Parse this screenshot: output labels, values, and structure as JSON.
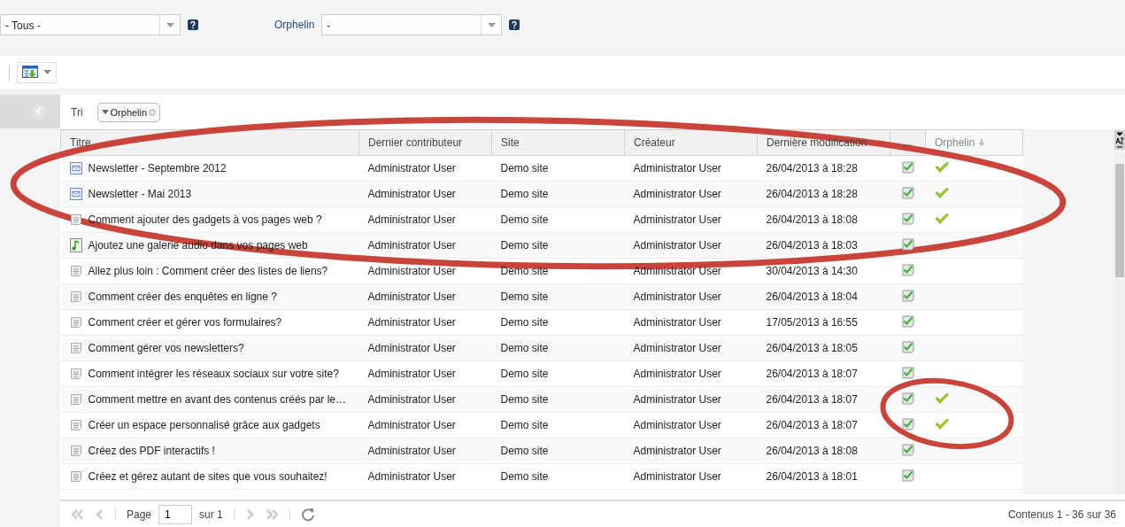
{
  "filters": [
    {
      "value": "- Tous -"
    },
    {
      "label": "Orphelin",
      "value": "-"
    }
  ],
  "sort_bar": {
    "label": "Tri",
    "chips": [
      "Orphelin"
    ]
  },
  "table": {
    "columns": [
      {
        "label": "Titre",
        "sorted": false
      },
      {
        "label": "Dernier contributeur",
        "sorted": false
      },
      {
        "label": "Site",
        "sorted": false
      },
      {
        "label": "Créateur",
        "sorted": false
      },
      {
        "label": "Dernière modification",
        "sorted": false
      },
      {
        "label": "...",
        "sorted": false
      },
      {
        "label": "Orphelin",
        "sorted": true
      }
    ],
    "rows": [
      {
        "kind": "newsletter",
        "title": "Newsletter - Septembre 2012",
        "contributor": "Administrator User",
        "site": "Demo site",
        "creator": "Administrator User",
        "modified": "26/04/2013 à 18:28",
        "orphan": true
      },
      {
        "kind": "newsletter",
        "title": "Newsletter - Mai 2013",
        "contributor": "Administrator User",
        "site": "Demo site",
        "creator": "Administrator User",
        "modified": "26/04/2013 à 18:28",
        "orphan": true
      },
      {
        "kind": "page",
        "title": "Comment ajouter des gadgets à vos pages web ?",
        "contributor": "Administrator User",
        "site": "Demo site",
        "creator": "Administrator User",
        "modified": "26/04/2013 à 18:08",
        "orphan": true
      },
      {
        "kind": "audio",
        "title": "Ajoutez une galerie audio dans vos pages web",
        "contributor": "Administrator User",
        "site": "Demo site",
        "creator": "Administrator User",
        "modified": "26/04/2013 à 18:03",
        "orphan": false
      },
      {
        "kind": "page",
        "title": "Allez plus loin : Comment créer des listes de liens?",
        "contributor": "Administrator User",
        "site": "Demo site",
        "creator": "Administrator User",
        "modified": "30/04/2013 à 14:30",
        "orphan": false
      },
      {
        "kind": "page",
        "title": "Comment créer des enquêtes en ligne ?",
        "contributor": "Administrator User",
        "site": "Demo site",
        "creator": "Administrator User",
        "modified": "26/04/2013 à 18:04",
        "orphan": false
      },
      {
        "kind": "page",
        "title": "Comment créer et gérer vos formulaires?",
        "contributor": "Administrator User",
        "site": "Demo site",
        "creator": "Administrator User",
        "modified": "17/05/2013 à 16:55",
        "orphan": false
      },
      {
        "kind": "page",
        "title": "Comment gérer vos newsletters?",
        "contributor": "Administrator User",
        "site": "Demo site",
        "creator": "Administrator User",
        "modified": "26/04/2013 à 18:05",
        "orphan": false
      },
      {
        "kind": "page",
        "title": "Comment intégrer les réseaux sociaux sur votre site?",
        "contributor": "Administrator User",
        "site": "Demo site",
        "creator": "Administrator User",
        "modified": "26/04/2013 à 18:07",
        "orphan": false
      },
      {
        "kind": "page",
        "title": "Comment mettre en avant des contenus créés par le…",
        "contributor": "Administrator User",
        "site": "Demo site",
        "creator": "Administrator User",
        "modified": "26/04/2013 à 18:07",
        "orphan": true
      },
      {
        "kind": "page",
        "title": "Créer un espace personnalisé grâce aux gadgets",
        "contributor": "Administrator User",
        "site": "Demo site",
        "creator": "Administrator User",
        "modified": "26/04/2013 à 18:07",
        "orphan": true
      },
      {
        "kind": "page",
        "title": "Créez des PDF interactifs !",
        "contributor": "Administrator User",
        "site": "Demo site",
        "creator": "Administrator User",
        "modified": "26/04/2013 à 18:08",
        "orphan": false
      },
      {
        "kind": "page",
        "title": "Créez et gérez autant de sites que vous souhaitez!",
        "contributor": "Administrator User",
        "site": "Demo site",
        "creator": "Administrator User",
        "modified": "26/04/2013 à 18:01",
        "orphan": false
      }
    ]
  },
  "pager": {
    "page_label": "Page",
    "page": "1",
    "of": "sur 1",
    "summary": "Contenus 1 - 36 sur 36"
  }
}
